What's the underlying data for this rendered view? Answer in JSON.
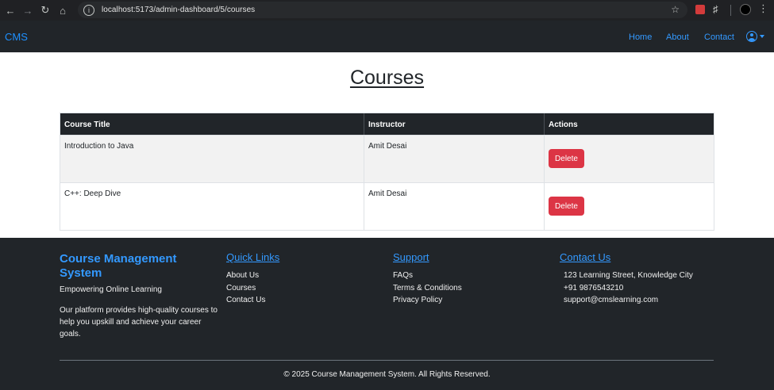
{
  "browser": {
    "url": "localhost:5173/admin-dashboard/5/courses"
  },
  "navbar": {
    "brand": "CMS",
    "links": [
      "Home",
      "About",
      "Contact"
    ]
  },
  "main": {
    "title": "Courses",
    "table": {
      "headers": [
        "Course Title",
        "Instructor",
        "Actions"
      ],
      "rows": [
        {
          "title": "Introduction to Java",
          "instructor": "Amit Desai",
          "action": "Delete"
        },
        {
          "title": "C++: Deep Dive",
          "instructor": "Amit Desai",
          "action": "Delete"
        }
      ]
    }
  },
  "footer": {
    "brand_title": "Course Management System",
    "tagline": "Empowering Online Learning",
    "description": "Our platform provides high-quality courses to help you upskill and achieve your career goals.",
    "quick_links": {
      "heading": "Quick Links",
      "items": [
        "About Us",
        "Courses",
        "Contact Us"
      ]
    },
    "support": {
      "heading": "Support",
      "items": [
        "FAQs",
        "Terms & Conditions",
        "Privacy Policy"
      ]
    },
    "contact": {
      "heading": "Contact Us",
      "items": [
        "123 Learning Street, Knowledge City",
        "+91 9876543210",
        "support@cmslearning.com"
      ]
    },
    "copyright": "© 2025 Course Management System. All Rights Reserved."
  },
  "colors": {
    "navbar_bg": "#212529",
    "brand_blue": "#3399ff",
    "danger": "#dc3545"
  }
}
